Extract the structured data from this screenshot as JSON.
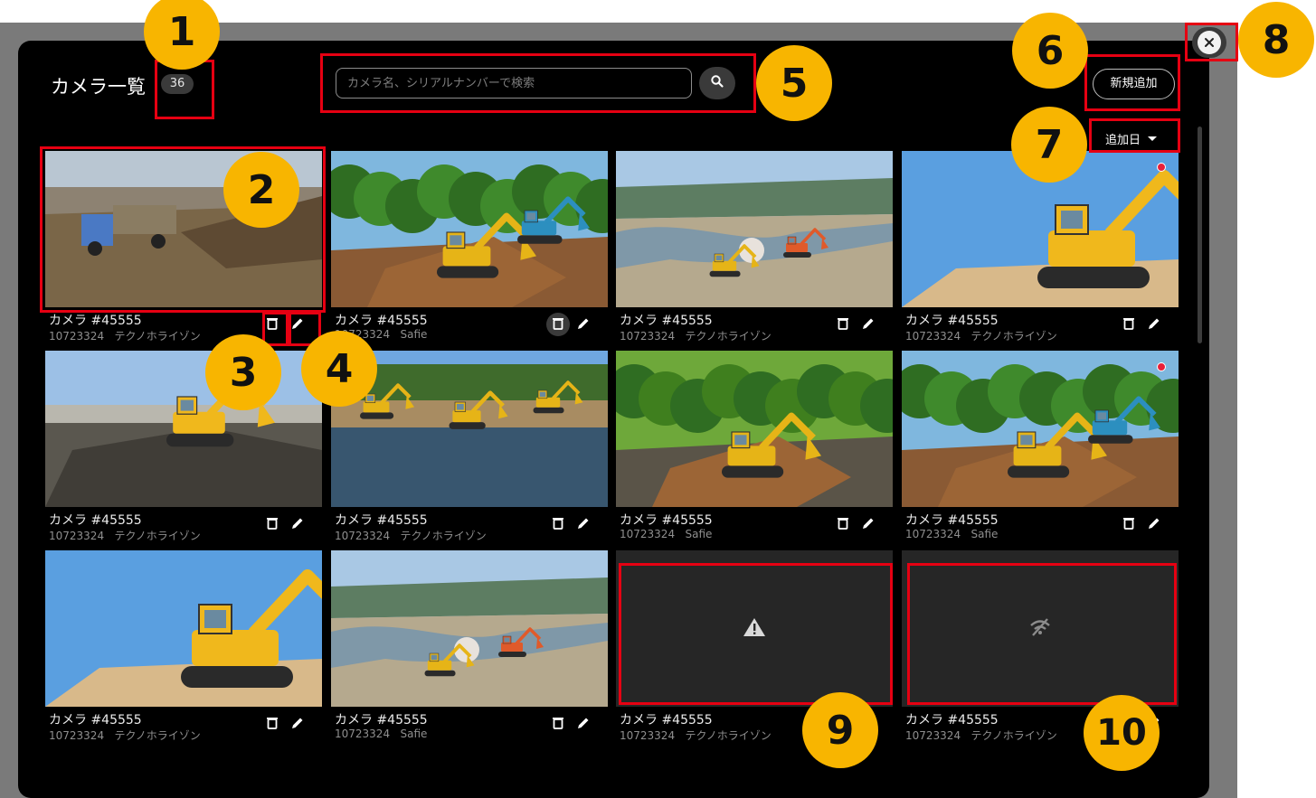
{
  "header": {
    "title": "カメラ一覧",
    "count": "36"
  },
  "search": {
    "placeholder": "カメラ名、シリアルナンバーで検索",
    "button_icon": "search-icon"
  },
  "toolbar": {
    "add_label": "新規追加",
    "sort_label": "追加日",
    "close_icon": "close-icon"
  },
  "colors": {
    "accent_red": "#e60012",
    "marker": "#f8b500",
    "rec_dot": "#e8203a",
    "background": "#000000"
  },
  "cameras": [
    {
      "name": "カメラ #45555",
      "serial": "10723324",
      "org": "テクノホライゾン",
      "status": "image",
      "scene": "truck",
      "recording": false
    },
    {
      "name": "カメラ #45555",
      "serial": "10723324",
      "org": "Safie",
      "status": "image",
      "scene": "trees",
      "recording": false
    },
    {
      "name": "カメラ #45555",
      "serial": "10723324",
      "org": "テクノホライゾン",
      "status": "image",
      "scene": "river",
      "recording": false
    },
    {
      "name": "カメラ #45555",
      "serial": "10723324",
      "org": "テクノホライゾン",
      "status": "image",
      "scene": "komatsu",
      "recording": true
    },
    {
      "name": "カメラ #45555",
      "serial": "10723324",
      "org": "テクノホライゾン",
      "status": "image",
      "scene": "gravel",
      "recording": false
    },
    {
      "name": "カメラ #45555",
      "serial": "10723324",
      "org": "テクノホライゾン",
      "status": "image",
      "scene": "water",
      "recording": false
    },
    {
      "name": "カメラ #45555",
      "serial": "10723324",
      "org": "Safie",
      "status": "image",
      "scene": "bamboo",
      "recording": false
    },
    {
      "name": "カメラ #45555",
      "serial": "10723324",
      "org": "Safie",
      "status": "image",
      "scene": "trees",
      "recording": true
    },
    {
      "name": "カメラ #45555",
      "serial": "10723324",
      "org": "テクノホライゾン",
      "status": "image",
      "scene": "komatsu",
      "recording": false
    },
    {
      "name": "カメラ #45555",
      "serial": "10723324",
      "org": "Safie",
      "status": "image",
      "scene": "river",
      "recording": false
    },
    {
      "name": "カメラ #45555",
      "serial": "10723324",
      "org": "テクノホライゾン",
      "status": "warning",
      "scene": "",
      "recording": false
    },
    {
      "name": "カメラ #45555",
      "serial": "10723324",
      "org": "テクノホライゾン",
      "status": "no-signal",
      "scene": "",
      "recording": false
    }
  ],
  "annotations": [
    "1",
    "2",
    "3",
    "4",
    "5",
    "6",
    "7",
    "8",
    "9",
    "10"
  ]
}
